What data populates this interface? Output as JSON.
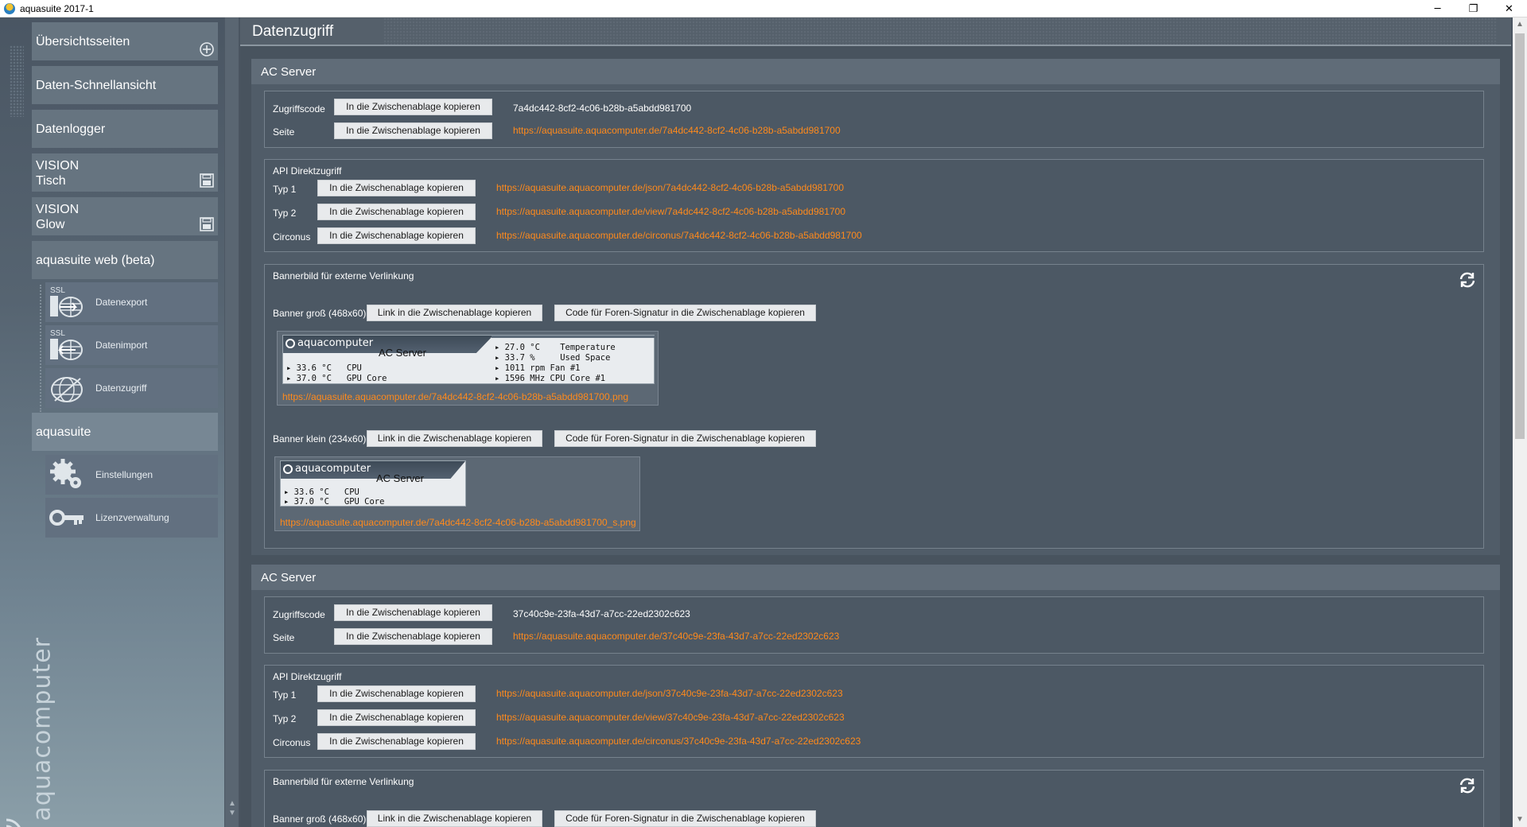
{
  "window": {
    "title": "aquasuite 2017-1",
    "minimize": "─",
    "restore": "❐",
    "close": "✕"
  },
  "sidebar": {
    "items": [
      {
        "label": "Übersichtsseiten",
        "icon": "add-circle-icon"
      },
      {
        "label": "Daten-Schnellansicht"
      },
      {
        "label": "Datenlogger"
      },
      {
        "label": "VISION\nTisch",
        "icon": "floppy-icon"
      },
      {
        "label": "VISION\nGlow",
        "icon": "floppy-icon"
      },
      {
        "label": "aquasuite web (beta)"
      },
      {
        "label": "aquasuite"
      }
    ],
    "web_sub": [
      {
        "label": "Datenexport",
        "icon": "ssl-export-icon",
        "ssl": "SSL"
      },
      {
        "label": "Datenimport",
        "icon": "ssl-import-icon",
        "ssl": "SSL"
      },
      {
        "label": "Datenzugriff",
        "icon": "globe-icon"
      }
    ],
    "suite_sub": [
      {
        "label": "Einstellungen",
        "icon": "gears-icon"
      },
      {
        "label": "Lizenzverwaltung",
        "icon": "key-icon"
      }
    ],
    "brand": "aquacomputer"
  },
  "main": {
    "title": "Datenzugriff",
    "copy_label": "In die Zwischenablage kopieren",
    "link_copy_label": "Link in die Zwischenablage kopieren",
    "code_copy_label": "Code für Foren-Signatur in die Zwischenablage kopieren",
    "labels": {
      "access_code": "Zugriffscode",
      "page": "Seite",
      "api": "API Direktzugriff",
      "type1": "Typ 1",
      "type2": "Typ 2",
      "circonus": "Circonus",
      "banner_section": "Bannerbild für externe Verlinkung",
      "banner_large": "Banner groß (468x60)",
      "banner_small": "Banner klein (234x60)"
    },
    "servers": [
      {
        "title": "AC Server",
        "access_code": "7a4dc442-8cf2-4c06-b28b-a5abdd981700",
        "page_url": "https://aquasuite.aquacomputer.de/7a4dc442-8cf2-4c06-b28b-a5abdd981700",
        "type1_url": "https://aquasuite.aquacomputer.de/json/7a4dc442-8cf2-4c06-b28b-a5abdd981700",
        "type2_url": "https://aquasuite.aquacomputer.de/view/7a4dc442-8cf2-4c06-b28b-a5abdd981700",
        "circonus_url": "https://aquasuite.aquacomputer.de/circonus/7a4dc442-8cf2-4c06-b28b-a5abdd981700",
        "banner_large_url": "https://aquasuite.aquacomputer.de/7a4dc442-8cf2-4c06-b28b-a5abdd981700.png",
        "banner_small_url": "https://aquasuite.aquacomputer.de/7a4dc442-8cf2-4c06-b28b-a5abdd981700_s.png",
        "banner": {
          "brand": "aquacomputer",
          "name": "AC Server",
          "left": [
            "33.6 °C   CPU",
            "37.0 °C   GPU Core"
          ],
          "right": [
            "27.0 °C    Temperature",
            "33.7 %     Used Space",
            "1011 rpm Fan #1",
            "1596 MHz CPU Core #1"
          ]
        }
      },
      {
        "title": "AC Server",
        "access_code": "37c40c9e-23fa-43d7-a7cc-22ed2302c623",
        "page_url": "https://aquasuite.aquacomputer.de/37c40c9e-23fa-43d7-a7cc-22ed2302c623",
        "type1_url": "https://aquasuite.aquacomputer.de/json/37c40c9e-23fa-43d7-a7cc-22ed2302c623",
        "type2_url": "https://aquasuite.aquacomputer.de/view/37c40c9e-23fa-43d7-a7cc-22ed2302c623",
        "circonus_url": "https://aquasuite.aquacomputer.de/circonus/37c40c9e-23fa-43d7-a7cc-22ed2302c623"
      }
    ]
  },
  "colors": {
    "link": "#ff8a1c",
    "background": "#48535e",
    "button": "#e8eaec"
  }
}
